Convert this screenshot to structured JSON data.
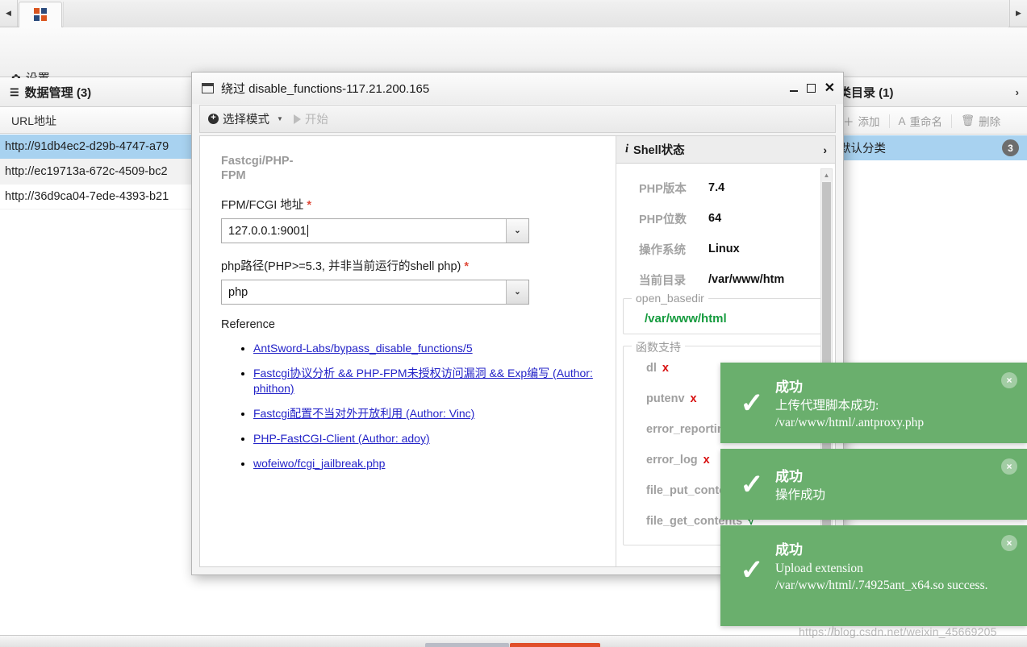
{
  "app": {
    "tab_icon": "grid-icon",
    "scroll_left_icon": "triangle-left-icon",
    "scroll_right_icon": "triangle-right-icon",
    "settings_label": "设置",
    "settings_icon": "gear-icon"
  },
  "left_panel": {
    "header": "数据管理 (3)",
    "header_icon": "list-icon",
    "column_header": "URL地址",
    "rows": [
      {
        "url": "http://91db4ec2-d29b-4747-a79"
      },
      {
        "url": "http://ec19713a-672c-4509-bc2"
      },
      {
        "url": "http://36d9ca04-7ede-4393-b21"
      }
    ]
  },
  "right_panel": {
    "header": "类目录 (1)",
    "header_chevron": "›",
    "toolbar": [
      {
        "label": "添加",
        "icon": "plus-icon"
      },
      {
        "label": "重命名",
        "icon": "rename-a-icon"
      },
      {
        "label": "删除",
        "icon": "trash-icon"
      }
    ],
    "row": {
      "label": "默认分类",
      "count": "3"
    }
  },
  "dialog": {
    "title": "绕过 disable_functions-117.21.200.165",
    "window_icon": "window-icon",
    "controls": {
      "minimize": "minimize-icon",
      "maximize": "maximize-icon",
      "close": "✕"
    },
    "toolbar": {
      "mode_label": "选择模式",
      "mode_icon": "plus-circle-icon",
      "dropdown_icon": "caret-down-icon",
      "start_label": "开始",
      "start_icon": "play-icon"
    },
    "form": {
      "section_title": "Fastcgi/PHP-FPM",
      "fields": [
        {
          "label": "FPM/FCGI 地址",
          "required": "*",
          "value": "127.0.0.1:9001"
        },
        {
          "label": "php路径(PHP>=5.3, 并非当前运行的shell php)",
          "required": "*",
          "value": "php"
        }
      ],
      "reference_title": "Reference",
      "reference_links": [
        "AntSword-Labs/bypass_disable_functions/5",
        "Fastcgi协议分析 && PHP-FPM未授权访问漏洞 && Exp编写 (Author: phithon)",
        "Fastcgi配置不当对外开放利用 (Author: Vinc)",
        "PHP-FastCGI-Client (Author: adoy)",
        "wofeiwo/fcgi_jailbreak.php"
      ]
    },
    "shell_status": {
      "header": "Shell状态",
      "header_icon": "info-icon",
      "header_chevron": "›",
      "info": [
        {
          "key": "PHP版本",
          "value": "7.4"
        },
        {
          "key": "PHP位数",
          "value": "64"
        },
        {
          "key": "操作系统",
          "value": "Linux"
        },
        {
          "key": "当前目录",
          "value": "/var/www/htm"
        }
      ],
      "open_basedir": {
        "legend": "open_basedir",
        "value": "/var/www/html"
      },
      "functions": {
        "legend": "函数支持",
        "items": [
          {
            "name": "dl",
            "status": "x",
            "ok": false
          },
          {
            "name": "putenv",
            "status": "x",
            "ok": false
          },
          {
            "name": "error_reporting",
            "status": "√",
            "ok": true
          },
          {
            "name": "error_log",
            "status": "x",
            "ok": false
          },
          {
            "name": "file_put_contents",
            "status": "√",
            "ok": true
          },
          {
            "name": "file_get_contents",
            "status": "√",
            "ok": true
          }
        ]
      },
      "scrollbar": {
        "up_icon": "caret-up-icon",
        "down_icon": "caret-down-icon"
      }
    }
  },
  "toasts": [
    {
      "title": "成功",
      "message": "上传代理脚本成功: /var/www/html/.antproxy.php",
      "icon": "check-icon",
      "close_icon": "×",
      "color": "#6aaf6d"
    },
    {
      "title": "成功",
      "message": "操作成功",
      "icon": "check-icon",
      "close_icon": "×",
      "color": "#6aaf6d"
    },
    {
      "title": "成功",
      "message": "Upload extension /var/www/html/.74925ant_x64.so success.",
      "icon": "check-icon",
      "close_icon": "×",
      "color": "#6aaf6d"
    }
  ],
  "watermark": "https://blog.csdn.net/weixin_45669205"
}
